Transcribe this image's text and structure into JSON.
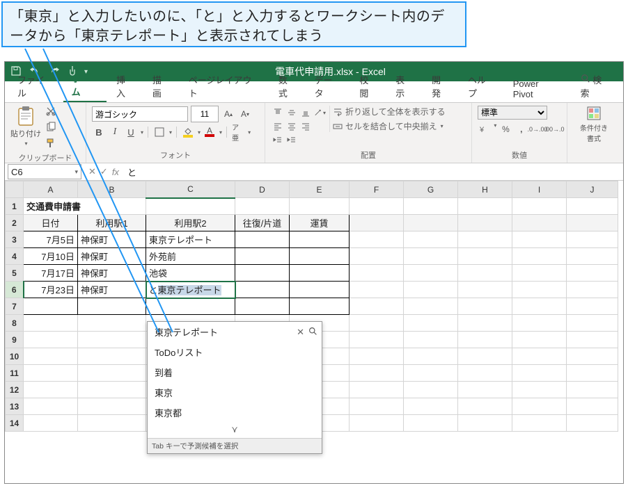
{
  "callout": {
    "text": "「東京」と入力したいのに、「と」と入力するとワークシート内のデータから「東京テレポート」と表示されてしまう"
  },
  "titlebar": {
    "title": "電車代申請用.xlsx  -  Excel"
  },
  "tabs": {
    "file": "ファイル",
    "home": "ホーム",
    "insert": "挿入",
    "draw": "描画",
    "layout": "ページレイアウト",
    "formulas": "数式",
    "data": "データ",
    "review": "校閲",
    "view": "表示",
    "dev": "開発",
    "help": "ヘルプ",
    "powerpivot": "Power Pivot",
    "search": "検索"
  },
  "ribbon": {
    "clipboard": {
      "paste": "貼り付け",
      "title": "クリップボード"
    },
    "font": {
      "name": "游ゴシック",
      "size": "11",
      "title": "フォント"
    },
    "align": {
      "wrap": "折り返して全体を表示する",
      "merge": "セルを結合して中央揃え",
      "title": "配置"
    },
    "number": {
      "fmt": "標準",
      "title": "数値"
    },
    "styles": {
      "cond": "条件付き\n書式"
    }
  },
  "fx": {
    "namebox": "C6",
    "formula": "と"
  },
  "sheet": {
    "cols": [
      "A",
      "B",
      "C",
      "D",
      "E",
      "F",
      "G",
      "H",
      "I",
      "J"
    ],
    "a1": "交通費申請書",
    "headers": {
      "a": "日付",
      "b": "利用駅1",
      "c": "利用駅2",
      "d": "往復/片道",
      "e": "運賃"
    },
    "rows": [
      {
        "date": "7月5日",
        "st1": "神保町",
        "st2": "東京テレポート"
      },
      {
        "date": "7月10日",
        "st1": "神保町",
        "st2": "外苑前"
      },
      {
        "date": "7月17日",
        "st1": "神保町",
        "st2": "池袋"
      },
      {
        "date": "7月23日",
        "st1": "神保町",
        "st2": ""
      }
    ],
    "editing": {
      "typed": "と",
      "suggest": "東京テレポート"
    }
  },
  "ime": {
    "items": [
      "東京テレポート",
      "ToDoリスト",
      "到着",
      "東京",
      "東京都"
    ],
    "hint": "Tab キーで予測候補を選択"
  }
}
